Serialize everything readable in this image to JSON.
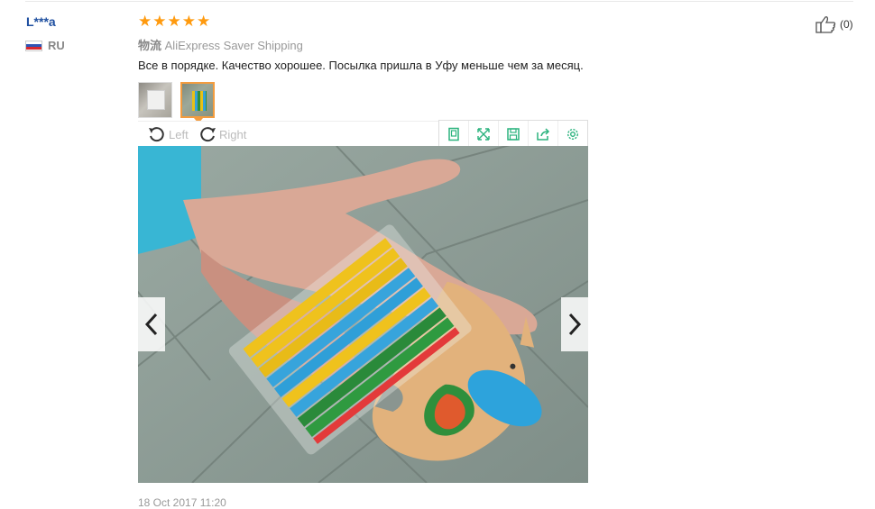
{
  "review": {
    "username": "L***a",
    "country_code": "RU",
    "rating": 5,
    "stars": [
      "★",
      "★",
      "★",
      "★",
      "★"
    ],
    "shipping_label": "物流",
    "shipping_method": "AliExpress Saver Shipping",
    "text": "Все в порядке. Качество хорошее. Посылка пришла в Уфу меньше чем за месяц.",
    "date": "18 Oct 2017 11:20",
    "likes": "(0)"
  },
  "viewer": {
    "rotate_left_label": "Left",
    "rotate_right_label": "Right",
    "tools": [
      "fit-screen-icon",
      "fullscreen-icon",
      "save-icon",
      "share-icon",
      "settings-icon"
    ],
    "prev_icon": "chevron-left-icon",
    "next_icon": "chevron-right-icon",
    "selected_thumbnail": 2
  },
  "colors": {
    "star": "#ff9a0e",
    "username": "#1e4fa0",
    "thumbnail_active_border": "#f39c3f",
    "toolbar_icon": "#2bb37e"
  }
}
